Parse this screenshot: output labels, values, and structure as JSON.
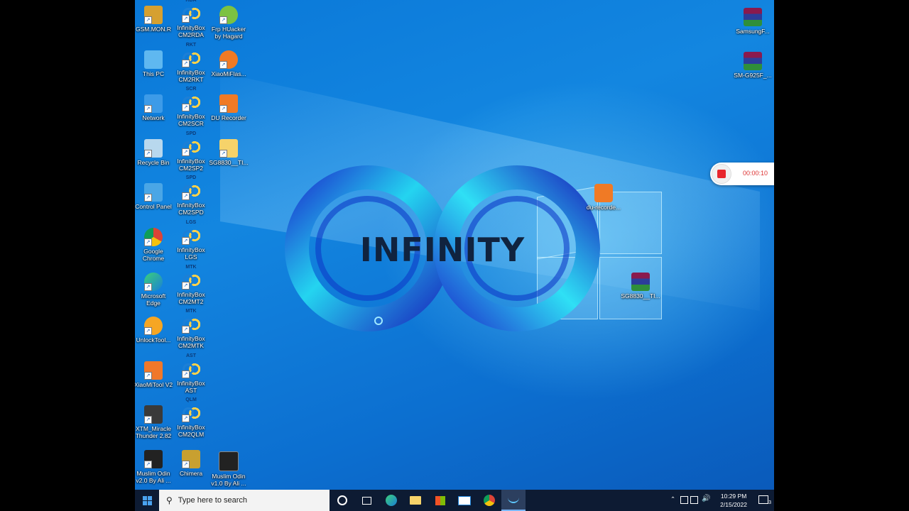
{
  "desktop": {
    "icons_col1": [
      {
        "label": "GSM.MON.R",
        "icon": "gsm-icon"
      },
      {
        "label": "This PC",
        "icon": "this-pc-icon"
      },
      {
        "label": "Network",
        "icon": "network-icon"
      },
      {
        "label": "Recycle Bin",
        "icon": "recycle-bin-icon"
      },
      {
        "label": "Control Panel",
        "icon": "control-panel-icon"
      },
      {
        "label": "Google Chrome",
        "icon": "chrome-icon"
      },
      {
        "label": "Microsoft Edge",
        "icon": "edge-icon"
      },
      {
        "label": "UnlockTool...",
        "icon": "unlocktool-icon"
      },
      {
        "label": "XiaoMiTool V2",
        "icon": "xiaomitool-icon"
      },
      {
        "label": "XTM_Miracle Thunder 2.82",
        "icon": "miracle-icon"
      },
      {
        "label": "Muslim Odin v2.0 By Ali ...",
        "icon": "odin-icon"
      }
    ],
    "icons_col2": [
      {
        "tag": "RDA",
        "label": "InfinityBox CM2RDA"
      },
      {
        "tag": "RKT",
        "label": "InfinityBox CM2RKT"
      },
      {
        "tag": "SCR",
        "label": "InfinityBox CM2SCR"
      },
      {
        "tag": "SPD",
        "label": "InfinityBox CM2SP2"
      },
      {
        "tag": "SPD",
        "label": "InfinityBox CM2SPD"
      },
      {
        "tag": "LGS",
        "label": "InfinityBox LGS"
      },
      {
        "tag": "MTK",
        "label": "InfinityBox CM2MT2"
      },
      {
        "tag": "MTK",
        "label": "InfinityBox CM2MTK"
      },
      {
        "tag": "AST",
        "label": "InfinityBox AST"
      },
      {
        "tag": "QLM",
        "label": "InfinityBox CM2QLM"
      },
      {
        "tag": "",
        "label": "Chimera"
      }
    ],
    "icons_col3": [
      {
        "label": "Frp HUacker by Hagard",
        "icon": "frp-icon"
      },
      {
        "label": "XiaoMiFlas...",
        "icon": "mi-icon"
      },
      {
        "label": "DU Recorder",
        "icon": "du-recorder-icon"
      },
      {
        "label": "SG8830__TI...",
        "icon": "folder-icon"
      }
    ],
    "icon_col3_bottom": {
      "label": "Muslim Odin v1.0 By Ali ...",
      "icon": "odin-icon"
    },
    "icons_right": [
      {
        "label": "SamsungF...",
        "icon": "winrar-icon"
      },
      {
        "label": "SM-G925F_...",
        "icon": "winrar-icon"
      }
    ],
    "icons_mid": [
      {
        "label": "du-recorde...",
        "icon": "du-recorder-icon"
      },
      {
        "label": "SG8830__TI...",
        "icon": "winrar-icon"
      }
    ],
    "wallpaper_text": "INFINITY"
  },
  "recorder": {
    "time": "00:00:10"
  },
  "taskbar": {
    "search_placeholder": "Type here to search",
    "time": "10:29 PM",
    "date": "2/15/2022",
    "notification_count": "3"
  },
  "colors": {
    "wallpaper": "#0a78d8",
    "taskbar": "#0d1b33",
    "record_red": "#e8262c"
  }
}
